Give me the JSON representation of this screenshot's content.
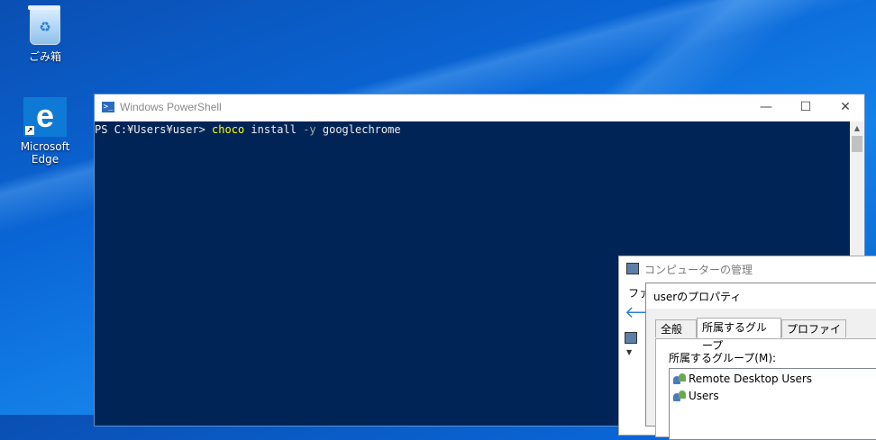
{
  "desktop": {
    "icons": [
      {
        "label": "ごみ箱",
        "icon": "recycle-bin-icon"
      },
      {
        "label": "Microsoft Edge",
        "icon": "edge-icon"
      }
    ]
  },
  "powershell": {
    "title": "Windows PowerShell",
    "prompt": "PS C:¥Users¥user> ",
    "command": {
      "cmd": "choco",
      "arg1": " install ",
      "param": "-y",
      "arg2": " googlechrome"
    },
    "controls": {
      "minimize": "—",
      "maximize": "☐",
      "close": "✕"
    },
    "colors": {
      "background": "#012456",
      "command": "#ffff00",
      "parameter": "#a9a9a9"
    }
  },
  "computer_management": {
    "title": "コンピューターの管理",
    "menu_partial": "ファイ"
  },
  "properties_dialog": {
    "title": "userのプロパティ",
    "tabs": [
      {
        "label": "全般",
        "active": false
      },
      {
        "label": "所属するグループ",
        "active": true
      },
      {
        "label": "プロファイル",
        "active": false
      }
    ],
    "groups_label": "所属するグループ(M):",
    "groups": [
      "Remote Desktop Users",
      "Users"
    ]
  }
}
